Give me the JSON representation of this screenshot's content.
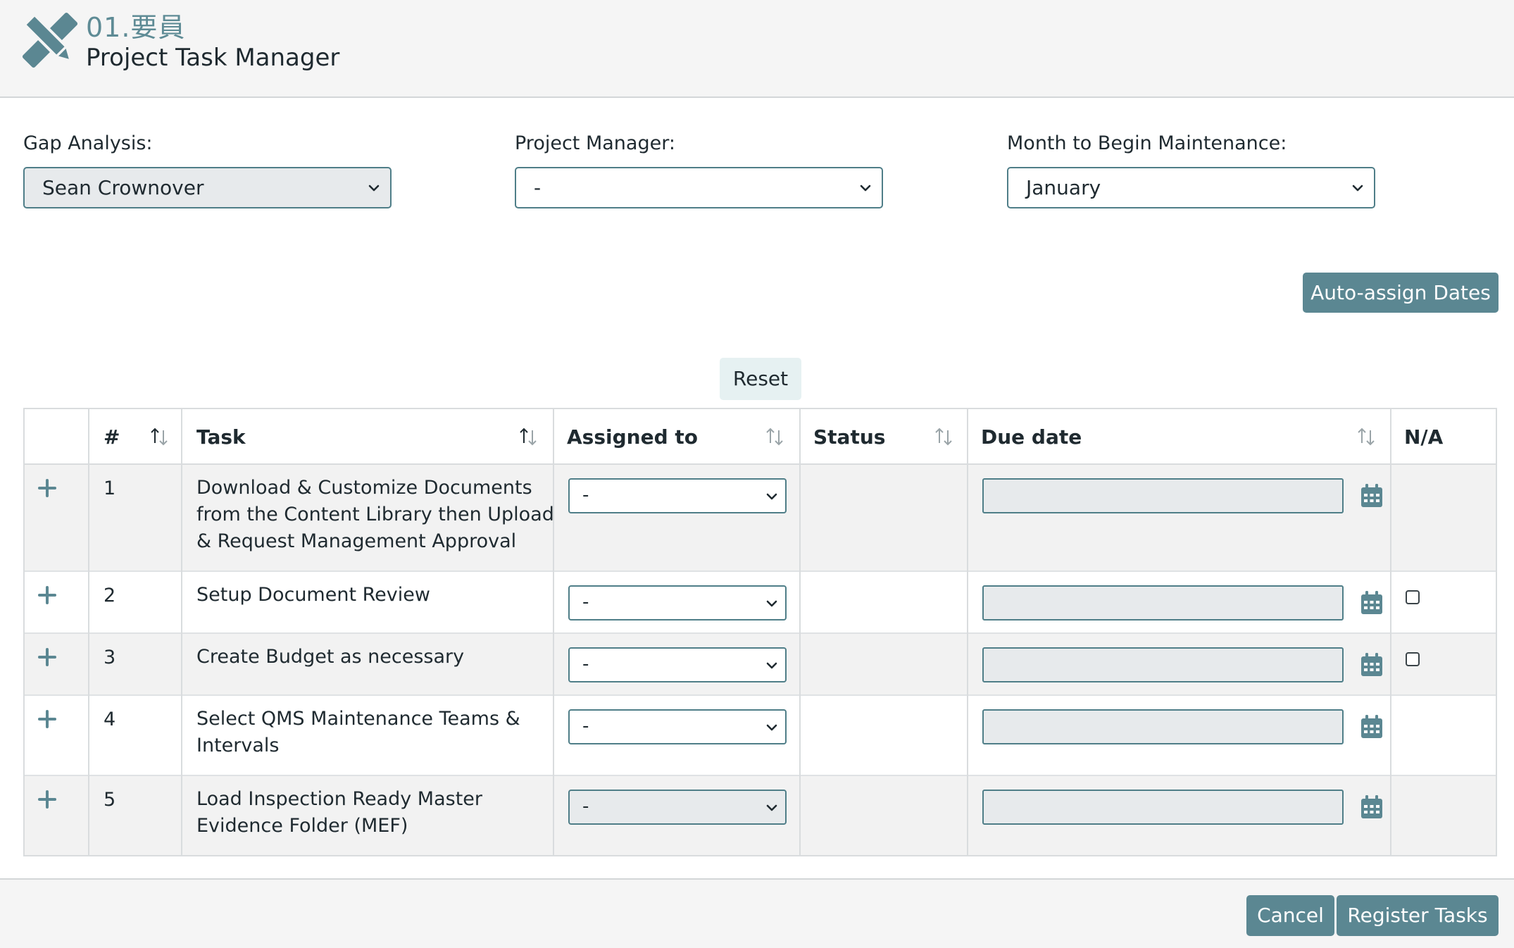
{
  "header": {
    "code": "01.要員",
    "title": "Project Task Manager"
  },
  "filters": {
    "gap_analysis": {
      "label": "Gap Analysis:",
      "value": "Sean Crownover"
    },
    "project_manager": {
      "label": "Project Manager:",
      "value": "-"
    },
    "month": {
      "label": "Month to Begin Maintenance:",
      "value": "January"
    }
  },
  "actions": {
    "auto_assign": "Auto-assign Dates",
    "reset": "Reset",
    "cancel": "Cancel",
    "register": "Register Tasks"
  },
  "table": {
    "columns": {
      "num": "#",
      "task": "Task",
      "assigned": "Assigned to",
      "status": "Status",
      "due": "Due date",
      "na": "N/A"
    },
    "rows": [
      {
        "num": "1",
        "task": "Download & Customize Documents from the Content Library then Upload & Request Management Approval",
        "assigned": "-",
        "status": "",
        "due": "",
        "na_checkbox": false
      },
      {
        "num": "2",
        "task": "Setup Document Review",
        "assigned": "-",
        "status": "",
        "due": "",
        "na_checkbox": true,
        "na_checked": false
      },
      {
        "num": "3",
        "task": "Create Budget as necessary",
        "assigned": "-",
        "status": "",
        "due": "",
        "na_checkbox": true,
        "na_checked": false
      },
      {
        "num": "4",
        "task": "Select QMS Maintenance Teams & Intervals",
        "assigned": "-",
        "status": "",
        "due": "",
        "na_checkbox": false
      },
      {
        "num": "5",
        "task": "Load Inspection Ready Master Evidence Folder (MEF)",
        "assigned": "-",
        "status": "",
        "due": "",
        "na_checkbox": false
      }
    ]
  },
  "icons": {
    "logo": "pencil-ruler-icon",
    "sort": "sort-arrows-icon",
    "expand": "plus-icon",
    "calendar": "calendar-icon",
    "dropdown": "chevron-down-icon"
  },
  "colors": {
    "accent": "#5b8792",
    "border": "#4f7e88",
    "header_bg": "#f5f5f5",
    "row_shade": "#f2f2f2"
  }
}
